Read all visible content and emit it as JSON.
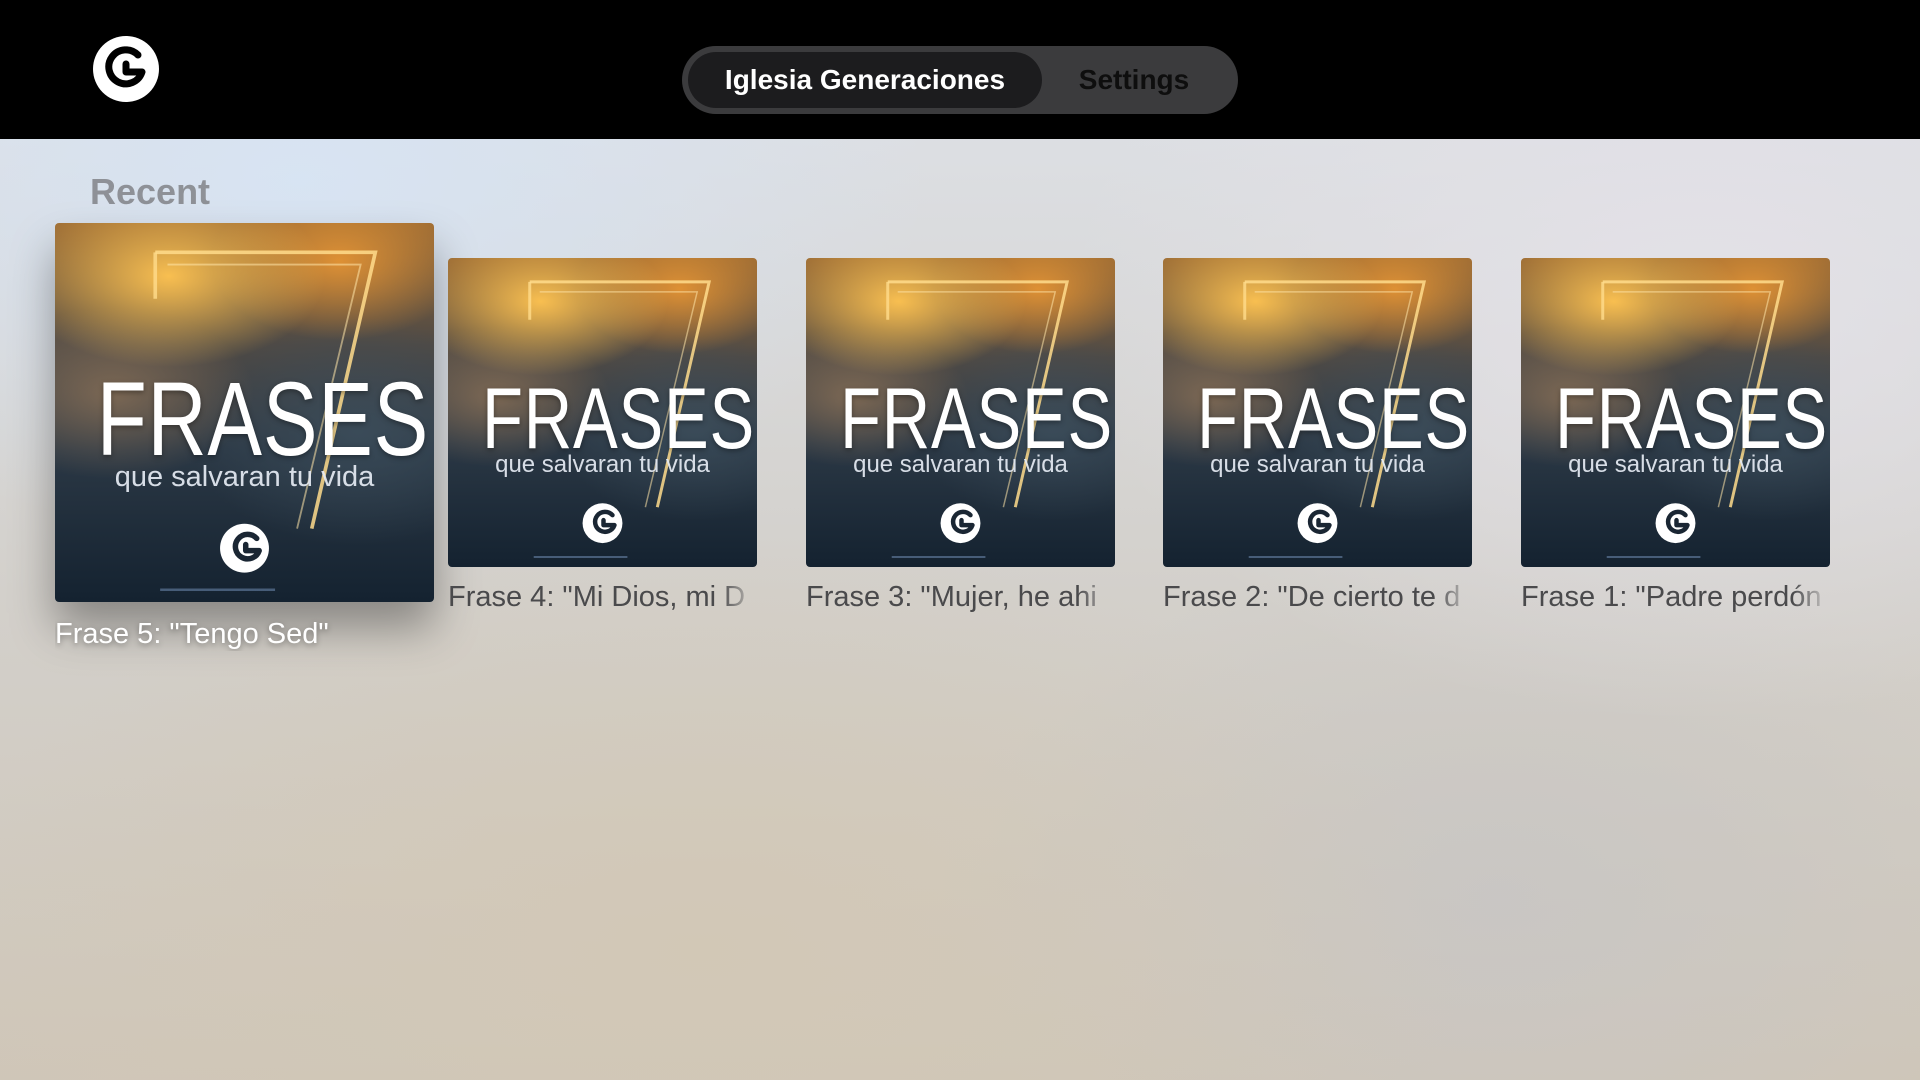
{
  "app": {
    "logo_icon": "church-g-logo-icon"
  },
  "nav": {
    "tabs": [
      {
        "label": "Iglesia Generaciones",
        "active": true
      },
      {
        "label": "Settings",
        "active": false
      }
    ]
  },
  "recent": {
    "title": "Recent",
    "items": [
      {
        "caption": "Frase 5: \"Tengo Sed\"",
        "art_title": "FRASES",
        "art_subtitle": "que salvaran tu vida",
        "art_numeral": "7",
        "focused": true
      },
      {
        "caption": "Frase 4: \"Mi Dios, mi D",
        "art_title": "FRASES",
        "art_subtitle": "que salvaran tu vida",
        "art_numeral": "7",
        "focused": false
      },
      {
        "caption": "Frase 3: \"Mujer, he ahi",
        "art_title": "FRASES",
        "art_subtitle": "que salvaran tu vida",
        "art_numeral": "7",
        "focused": false
      },
      {
        "caption": "Frase 2: \"De cierto te d",
        "art_title": "FRASES",
        "art_subtitle": "que salvaran tu vida",
        "art_numeral": "7",
        "focused": false
      },
      {
        "caption": "Frase 1: \"Padre perdón",
        "art_title": "FRASES",
        "art_subtitle": "que salvaran tu vida",
        "art_numeral": "7",
        "focused": false
      }
    ]
  },
  "colors": {
    "topbar": "#000000",
    "pill": "#3b3b3d",
    "active_tab": "#1c1c1e",
    "section_title": "#8e9197",
    "caption": "#4a4a4c",
    "caption_focused": "#ffffff"
  }
}
